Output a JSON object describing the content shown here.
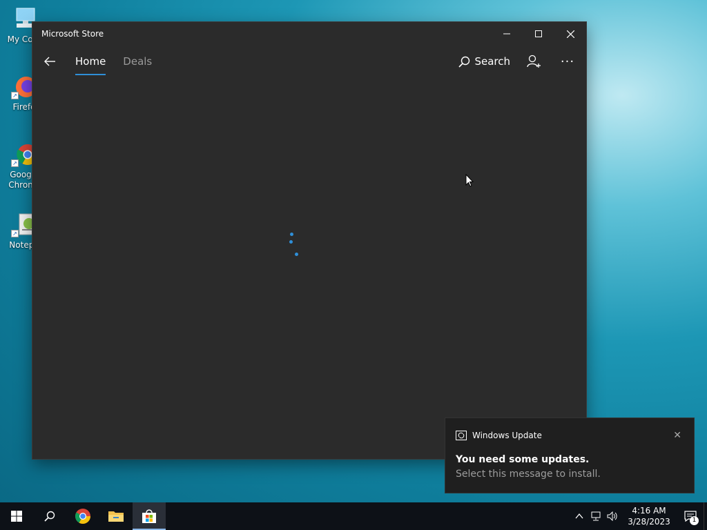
{
  "desktop": {
    "icons": [
      {
        "label": "My Com",
        "icon": "computer-icon"
      },
      {
        "label": "Firefo",
        "icon": "firefox-icon"
      },
      {
        "label": "Goog Chron",
        "icon": "chrome-icon"
      },
      {
        "label": "Notepa",
        "icon": "notepad-icon"
      }
    ]
  },
  "window": {
    "title": "Microsoft Store",
    "controls": {
      "minimize": "—",
      "maximize": "☐",
      "close": "✕"
    },
    "nav": {
      "back_icon": "back-arrow-icon",
      "tabs": [
        {
          "label": "Home",
          "active": true
        },
        {
          "label": "Deals",
          "active": false
        }
      ],
      "search_label": "Search",
      "more_label": "···"
    },
    "loading": true,
    "accent": "#2f8fd8"
  },
  "toast": {
    "app": "Windows Update",
    "title": "You need some updates.",
    "message": "Select this message to install.",
    "close": "✕"
  },
  "taskbar": {
    "time": "4:16 AM",
    "date": "3/28/2023",
    "notification_count": "1",
    "apps": [
      "start-icon",
      "search-icon",
      "chrome-icon",
      "file-explorer-icon",
      "microsoft-store-icon"
    ]
  }
}
